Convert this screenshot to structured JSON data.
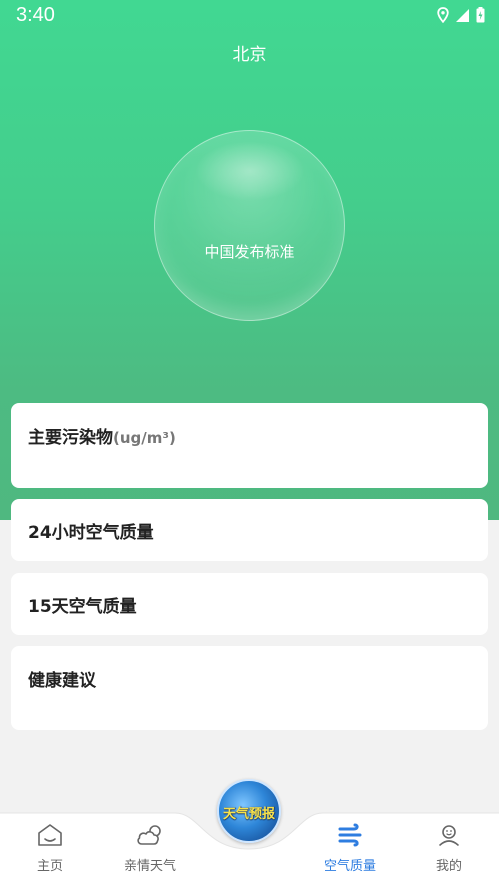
{
  "status_bar": {
    "time": "3:40"
  },
  "header": {
    "city": "北京"
  },
  "aqi_bubble": {
    "label": "中国发布标准"
  },
  "cards": {
    "pollutants": {
      "title": "主要污染物",
      "unit": "(ug/m³)"
    },
    "hourly": {
      "title": "24小时空气质量"
    },
    "daily": {
      "title": "15天空气质量"
    },
    "advice": {
      "title": "健康建议"
    }
  },
  "tabbar": {
    "home": "主页",
    "family": "亲情天气",
    "center": "天气预报",
    "air": "空气质量",
    "mine": "我的"
  },
  "colors": {
    "accent": "#2e7de0",
    "hero_top": "#41d892",
    "hero_bottom": "#4fb880"
  }
}
